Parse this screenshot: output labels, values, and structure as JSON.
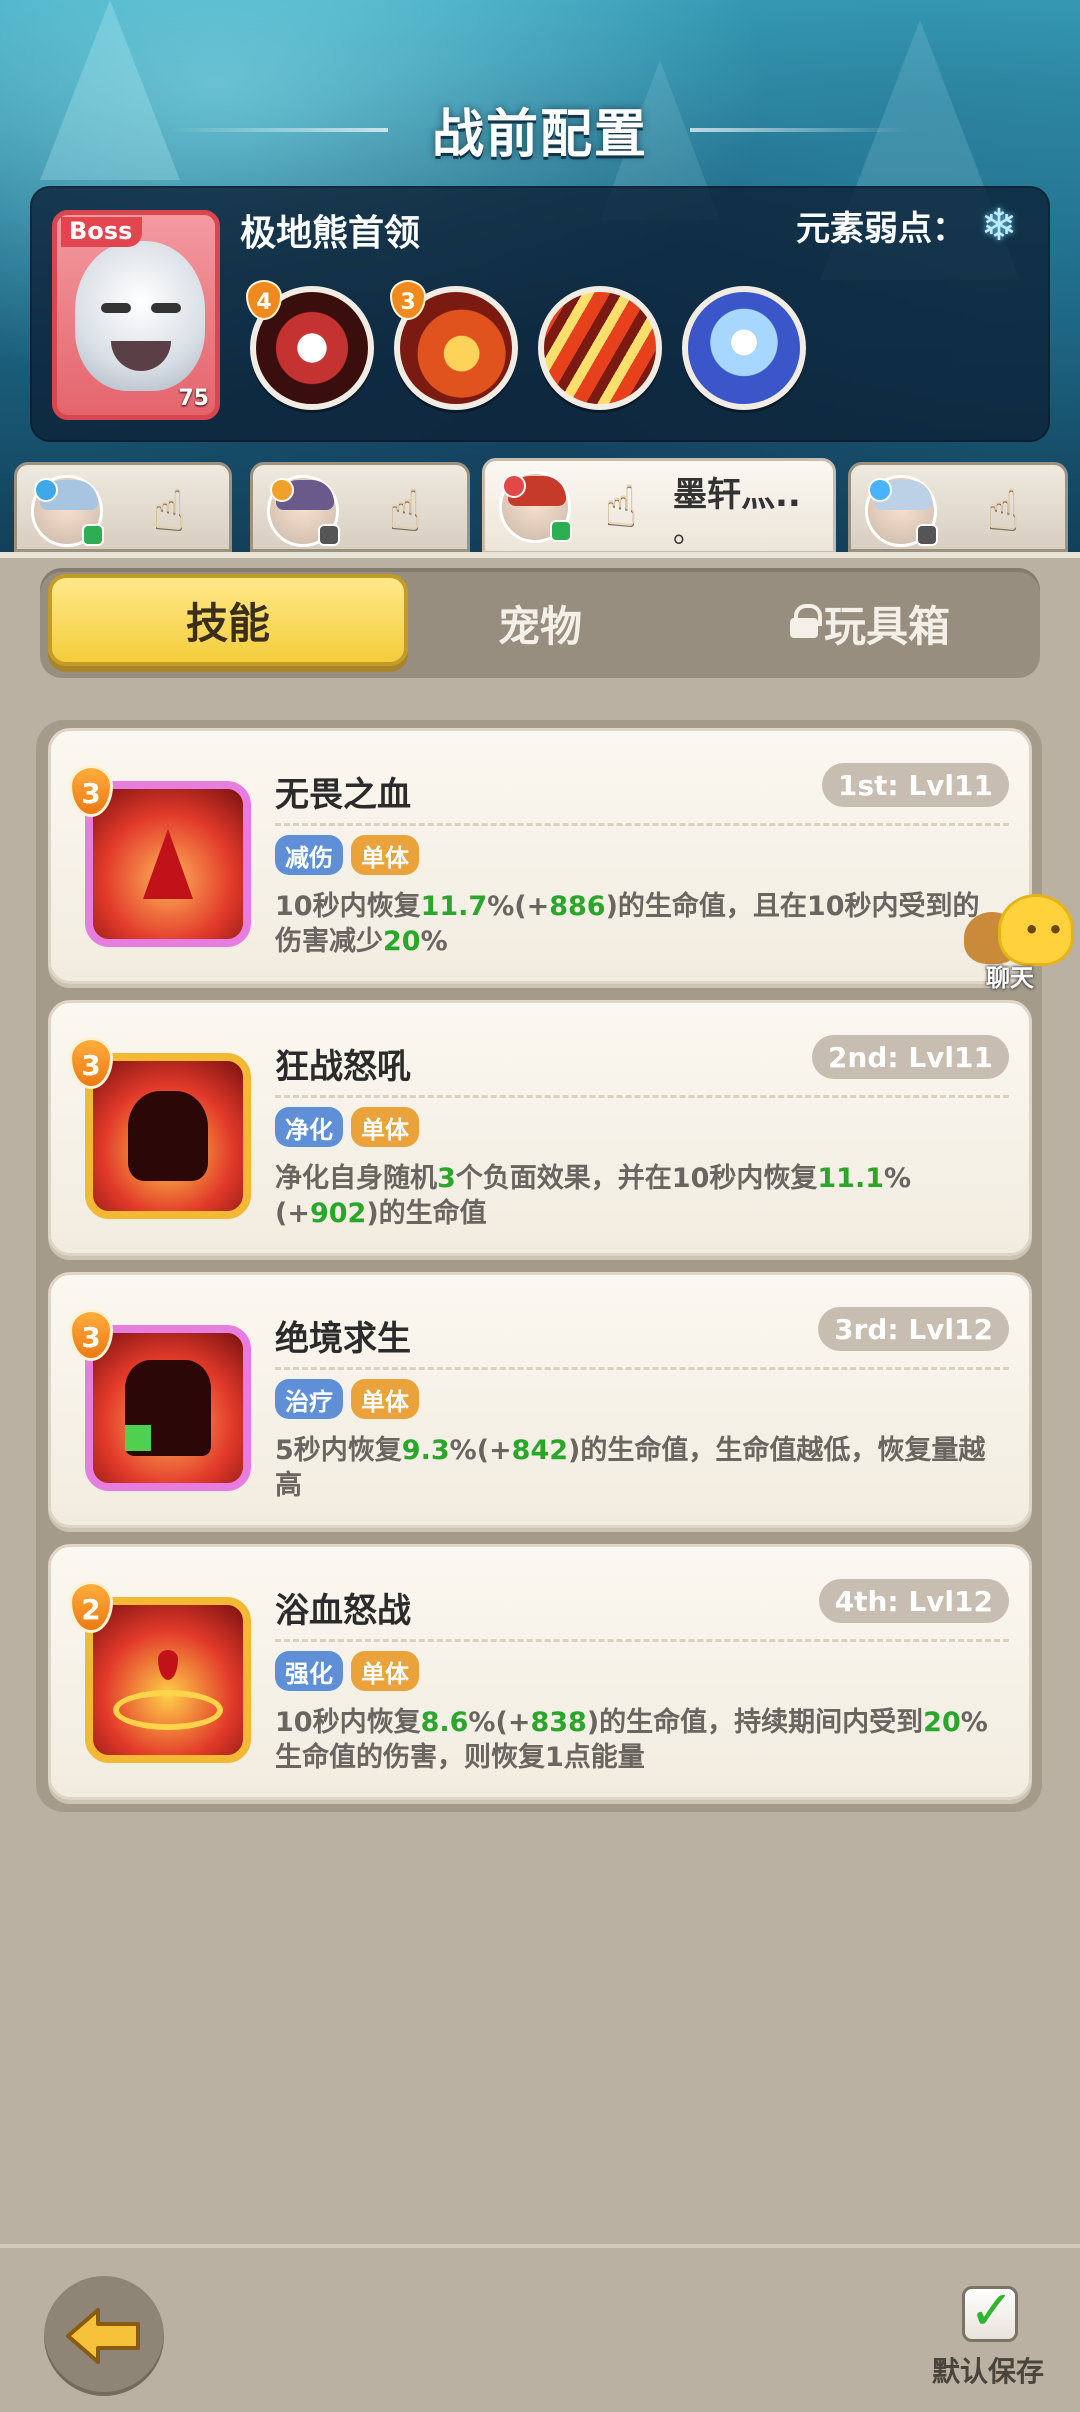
{
  "page": {
    "title": "战前配置"
  },
  "boss": {
    "tag": "Boss",
    "level": "75",
    "name": "极地熊首领",
    "weakness_label": "元素弱点：",
    "weakness_icon": "snowflake-icon",
    "skills": [
      {
        "icon": "fangs-skill-icon",
        "cost": "4"
      },
      {
        "icon": "fist-skill-icon",
        "cost": "3"
      },
      {
        "icon": "claw-slash-skill-icon",
        "cost": ""
      },
      {
        "icon": "ice-crystal-skill-icon",
        "cost": ""
      }
    ]
  },
  "heroes": [
    {
      "name": "",
      "element_color": "#3fa8e8"
    },
    {
      "name": "",
      "element_color": "#f0a12a"
    },
    {
      "name": "墨轩灬..",
      "name2": "。",
      "element_color": "#e34848",
      "active": true
    },
    {
      "name": "",
      "element_color": "#4ab3ff"
    }
  ],
  "tabs": {
    "skills": "技能",
    "pets": "宠物",
    "toybox": "玩具箱",
    "active": "skills"
  },
  "skills": [
    {
      "name": "无畏之血",
      "level": "1st: Lvl11",
      "cost": "3",
      "frame": "pink",
      "tags": [
        "减伤",
        "单体"
      ],
      "desc_parts": [
        "10秒内恢复",
        "11.7",
        "%(+",
        "886",
        ")的生命值，且在10秒内受到的伤害减少",
        "20",
        "%"
      ]
    },
    {
      "name": "狂战怒吼",
      "level": "2nd: Lvl11",
      "cost": "3",
      "frame": "gold",
      "tags": [
        "净化",
        "单体"
      ],
      "desc_parts": [
        "净化自身随机",
        "3",
        "个负面效果，并在10秒内恢复",
        "11.1",
        "%(+",
        "902",
        ")的生命值"
      ]
    },
    {
      "name": "绝境求生",
      "level": "3rd: Lvl12",
      "cost": "3",
      "frame": "pink",
      "tags": [
        "治疗",
        "单体"
      ],
      "desc_parts": [
        "5秒内恢复",
        "9.3",
        "%(+",
        "842",
        ")的生命值，生命值越低，恢复量越高"
      ]
    },
    {
      "name": "浴血怒战",
      "level": "4th: Lvl12",
      "cost": "2",
      "frame": "gold",
      "tags": [
        "强化",
        "单体"
      ],
      "desc_parts": [
        "10秒内恢复",
        "8.6",
        "%(+",
        "838",
        ")的生命值，持续期间内受到",
        "20",
        "%生命值的伤害，则恢复1点能量"
      ]
    }
  ],
  "chat": {
    "label": "聊天"
  },
  "footer": {
    "save_label": "默认保存",
    "save_checked": true
  },
  "colors": {
    "highlight_number": "#2aa62a",
    "active_tab": "#f4cd3b"
  }
}
